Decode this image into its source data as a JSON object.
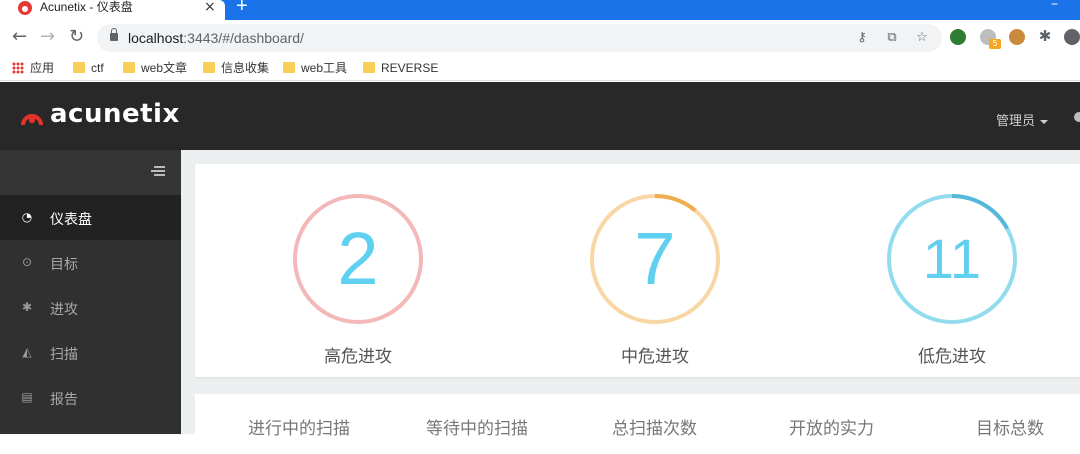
{
  "browser": {
    "tab_title": "Acunetix - 仪表盘",
    "tab_close": "×",
    "new_tab": "+",
    "window_min": "–",
    "nav_back": "←",
    "nav_forward": "→",
    "nav_reload": "↻",
    "url_host": "localhost",
    "url_rest": ":3443/#/dashboard/",
    "bookmarks": [
      "应用",
      "ctf",
      "web文章",
      "信息收集",
      "web工具",
      "REVERSE"
    ],
    "extension_badge": "5"
  },
  "header": {
    "logo_text": "acunetix",
    "admin_label": "管理员"
  },
  "sidebar": {
    "items": [
      {
        "label": "仪表盘",
        "icon": "dashboard-icon",
        "active": true
      },
      {
        "label": "目标",
        "icon": "target-icon",
        "active": false
      },
      {
        "label": "进攻",
        "icon": "bug-icon",
        "active": false
      },
      {
        "label": "扫描",
        "icon": "area-chart-icon",
        "active": false
      },
      {
        "label": "报告",
        "icon": "document-icon",
        "active": false
      }
    ]
  },
  "gauges": [
    {
      "value": "2",
      "label": "高危进攻",
      "track_color": "#f4b8b8",
      "fill_color": "#ef8e8e",
      "fill_fraction": 0.0
    },
    {
      "value": "7",
      "label": "中危进攻",
      "track_color": "#f9d7a4",
      "fill_color": "#f0ad4e",
      "fill_fraction": 0.11
    },
    {
      "value": "11",
      "label": "低危进攻",
      "track_color": "#93dcee",
      "fill_color": "#56b8d8",
      "fill_fraction": 0.17
    }
  ],
  "stats": {
    "labels": [
      "进行中的扫描",
      "等待中的扫描",
      "总扫描次数",
      "开放的实力",
      "目标总数"
    ]
  },
  "colors": {
    "brand_red": "#e5332a",
    "header_bg": "#282828",
    "sidebar_bg": "#303030",
    "number_color": "#5fd0f0"
  }
}
